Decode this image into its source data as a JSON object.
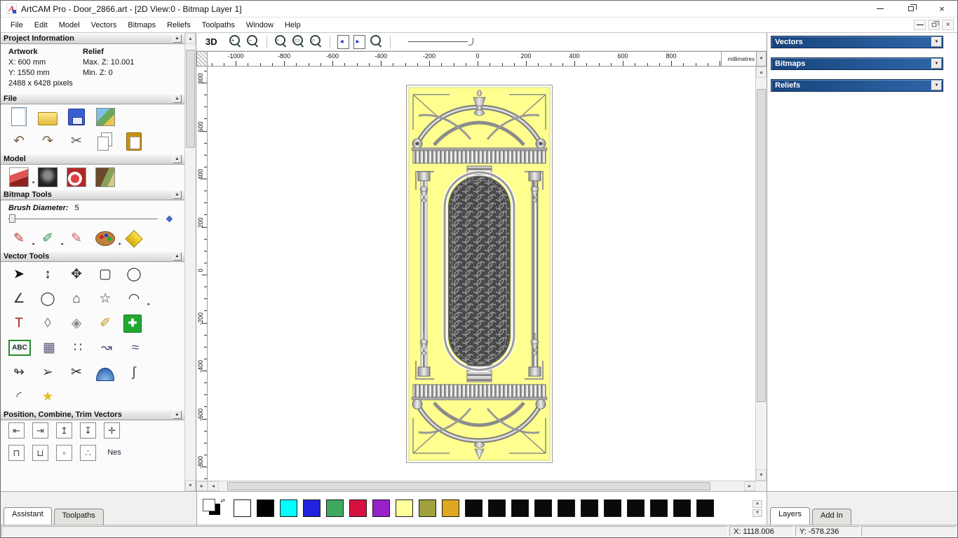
{
  "window": {
    "title": "ArtCAM Pro - Door_2866.art - [2D View:0 - Bitmap Layer 1]",
    "logo": "A",
    "controls": {
      "close": "×"
    },
    "mdi": {
      "close": "×"
    }
  },
  "glyphs": {
    "up": "▲",
    "down": "▼",
    "left": "◄",
    "right": "►",
    "dropdown": "▼",
    "collapse": "▲",
    "swap": "⇄"
  },
  "menu": {
    "items": [
      "File",
      "Edit",
      "Model",
      "Vectors",
      "Bitmaps",
      "Reliefs",
      "Toolpaths",
      "Window",
      "Help"
    ]
  },
  "assistant": {
    "project": {
      "title": "Project Information",
      "artwork_label": "Artwork",
      "relief_label": "Relief",
      "x": "X: 600 mm",
      "y": "Y: 1550 mm",
      "pixels": "2488 x 6428 pixels",
      "max_z": "Max. Z: 10.001",
      "min_z": "Min. Z: 0"
    },
    "file": {
      "title": "File",
      "rows": [
        [
          {
            "name": "new-model-icon",
            "cls": "page"
          },
          {
            "name": "open-file-icon",
            "cls": "folder"
          },
          {
            "name": "save-file-icon",
            "cls": "floppy"
          },
          {
            "name": "import-image-icon",
            "cls": "pic"
          }
        ],
        [
          {
            "name": "undo-icon",
            "glyph": "↶",
            "color": "#776644"
          },
          {
            "name": "redo-icon",
            "glyph": "↷",
            "color": "#776644"
          },
          {
            "name": "cut-icon",
            "glyph": "✂",
            "color": "#555555"
          },
          {
            "name": "copy-icon",
            "cls": "copy"
          },
          {
            "name": "paste-icon",
            "cls": "paste"
          }
        ]
      ]
    },
    "model": {
      "title": "Model",
      "rows": [
        [
          {
            "name": "set-model-size-icon",
            "cls": "pic-red",
            "arrow": "▸"
          },
          {
            "name": "adjust-model-icon",
            "cls": "pic-dark"
          },
          {
            "name": "sculpt-model-icon",
            "cls": "pic-red2"
          },
          {
            "name": "texture-relief-icon",
            "cls": "pic-art"
          }
        ]
      ]
    },
    "bitmap_tools": {
      "title": "Bitmap Tools",
      "brush_label": "Brush Diameter:",
      "brush_value": "5",
      "rows": [
        [
          {
            "name": "paint-brush-icon",
            "glyph": "✎",
            "color": "#c03030",
            "arrow": "▸"
          },
          {
            "name": "paint-selective-icon",
            "glyph": "✐",
            "color": "#2d8a4e",
            "arrow": "▸"
          },
          {
            "name": "draw-colour-icon",
            "glyph": "✎",
            "color": "#d06060"
          },
          {
            "name": "colour-palette-icon",
            "cls": "palette",
            "arrow": "▸"
          },
          {
            "name": "flood-fill-icon",
            "cls": "bucket"
          }
        ]
      ]
    },
    "vector_tools": {
      "title": "Vector Tools",
      "rows": [
        [
          {
            "name": "select-vectors-icon",
            "glyph": "➤",
            "cls": "rot-nw",
            "color": "#111111"
          },
          {
            "name": "node-editing-icon",
            "glyph": "↕",
            "color": "#111111"
          },
          {
            "name": "transform-vectors-icon",
            "glyph": "✥",
            "color": "#333333"
          },
          {
            "name": "create-rectangle-icon",
            "glyph": "▢",
            "color": "#333333"
          },
          {
            "name": "create-circle-icon",
            "glyph": "◯",
            "color": "#333333"
          }
        ],
        [
          {
            "name": "create-polyline-icon",
            "glyph": "∠",
            "color": "#333333"
          },
          {
            "name": "create-ellipse-icon",
            "glyph": "◯",
            "cls": "squash",
            "color": "#333333"
          },
          {
            "name": "create-polygon-icon",
            "glyph": "⌂",
            "color": "#333333"
          },
          {
            "name": "create-star-icon",
            "glyph": "☆",
            "color": "#333333"
          },
          {
            "name": "create-arc-icon",
            "glyph": "◠",
            "color": "#333333",
            "arrow": "▸"
          }
        ],
        [
          {
            "name": "create-text-icon",
            "glyph": "T",
            "cls": "serif",
            "color": "#b02020"
          },
          {
            "name": "wrap-text-icon",
            "glyph": "◊",
            "color": "#777777"
          },
          {
            "name": "offset-vectors-icon",
            "glyph": "◈",
            "color": "#888888"
          },
          {
            "name": "measure-icon",
            "glyph": "✐",
            "color": "#c89010"
          },
          {
            "name": "block-copy-icon",
            "glyph": "✚",
            "cls": "green-plus"
          }
        ],
        [
          {
            "name": "convert-text-icon",
            "label": "ABC",
            "cls": "abc"
          },
          {
            "name": "paste-grid-icon",
            "glyph": "▦",
            "color": "#555577"
          },
          {
            "name": "nest-dots-icon",
            "glyph": "∷",
            "color": "#555577"
          },
          {
            "name": "paste-along-curve-icon",
            "glyph": "↝",
            "color": "#555577"
          },
          {
            "name": "fit-curves-icon",
            "glyph": "≈",
            "color": "#555577"
          }
        ],
        [
          {
            "name": "join-vectors-icon",
            "glyph": "↬",
            "color": "#444444"
          },
          {
            "name": "measure-arrow-icon",
            "glyph": "➢",
            "color": "#444444"
          },
          {
            "name": "trim-vectors-icon",
            "glyph": "✂",
            "cls": "rot90",
            "color": "#222222"
          },
          {
            "name": "extrude-dome-icon",
            "cls": "dome"
          },
          {
            "name": "spline-edit-icon",
            "glyph": "∫",
            "color": "#444444"
          }
        ],
        [
          {
            "name": "fillet-icon",
            "glyph": "◜",
            "color": "#555555"
          },
          {
            "name": "bitmap-to-vector-icon",
            "glyph": "★",
            "color": "#e8c020"
          }
        ]
      ]
    },
    "position": {
      "title": "Position, Combine, Trim Vectors",
      "rows": [
        [
          {
            "name": "align-left-icon",
            "glyph": "⇤",
            "cls": "box"
          },
          {
            "name": "align-right-icon",
            "glyph": "⇥",
            "cls": "box"
          },
          {
            "name": "align-top-icon",
            "glyph": "↥",
            "cls": "box"
          },
          {
            "name": "align-bottom-icon",
            "glyph": "↧",
            "cls": "box"
          },
          {
            "name": "align-center-icon",
            "glyph": "✛",
            "cls": "box"
          }
        ],
        [
          {
            "name": "combine-union-icon",
            "glyph": "⊓",
            "cls": "box"
          },
          {
            "name": "combine-subtract-icon",
            "glyph": "⊔",
            "cls": "box"
          },
          {
            "name": "trim-small-icon",
            "glyph": "▫",
            "cls": "box"
          },
          {
            "name": "scatter-copies-icon",
            "glyph": "∴",
            "cls": "box"
          },
          {
            "name": "nesting-icon",
            "label": "Nes",
            "cls": "nes"
          }
        ]
      ]
    },
    "tabs": [
      {
        "label": "Assistant",
        "active": true
      },
      {
        "label": "Toolpaths",
        "active": false
      }
    ]
  },
  "toolbar": {
    "view_toggle": "3D",
    "icons": [
      {
        "name": "zoom-in-icon",
        "cls": "mag",
        "glyph": "+"
      },
      {
        "name": "zoom-out-icon",
        "cls": "mag",
        "glyph": "−"
      },
      {
        "sep": true
      },
      {
        "name": "zoom-window-icon",
        "cls": "mag",
        "glyph": "▫"
      },
      {
        "name": "zoom-fit-icon",
        "cls": "mag",
        "glyph": "▭"
      },
      {
        "name": "zoom-objects-icon",
        "cls": "mag",
        "glyph": "○"
      },
      {
        "sep": true
      },
      {
        "name": "previous-bitmap-layer-icon",
        "cls": "page-arrow",
        "glyph": "◂"
      },
      {
        "name": "next-bitmap-layer-icon",
        "cls": "page-arrow",
        "glyph": "▸"
      },
      {
        "name": "zoom-previous-icon",
        "cls": "mag",
        "glyph": ""
      },
      {
        "sep": true
      },
      {
        "name": "line-width-slider",
        "cls": "hslider"
      }
    ]
  },
  "ruler": {
    "unit": "millimetres",
    "h_ticks": [
      -1000,
      -800,
      -600,
      -400,
      -200,
      0,
      200,
      400,
      600,
      800
    ],
    "v_ticks": [
      800,
      600,
      400,
      200,
      0,
      -200,
      -400,
      -600,
      -800
    ]
  },
  "right_panel": {
    "headers": [
      {
        "label": "Vectors"
      },
      {
        "label": "Bitmaps"
      },
      {
        "label": "Reliefs"
      }
    ],
    "tabs": [
      {
        "label": "Layers",
        "active": true
      },
      {
        "label": "Add In",
        "active": false
      }
    ]
  },
  "palette": {
    "colors": [
      "#ffffff",
      "#000000",
      "#00ffff",
      "#2222dd",
      "#3fa85f",
      "#d81040",
      "#9820c8",
      "#ffff9c",
      "#a0a040",
      "#e0a820",
      "#0a0a0a",
      "#0a0a0a",
      "#0a0a0a",
      "#0a0a0a",
      "#0a0a0a",
      "#0a0a0a",
      "#0a0a0a",
      "#0a0a0a",
      "#0a0a0a",
      "#0a0a0a",
      "#0a0a0a"
    ]
  },
  "status": {
    "x": "X: 1118.006",
    "y": "Y: -578.236"
  }
}
